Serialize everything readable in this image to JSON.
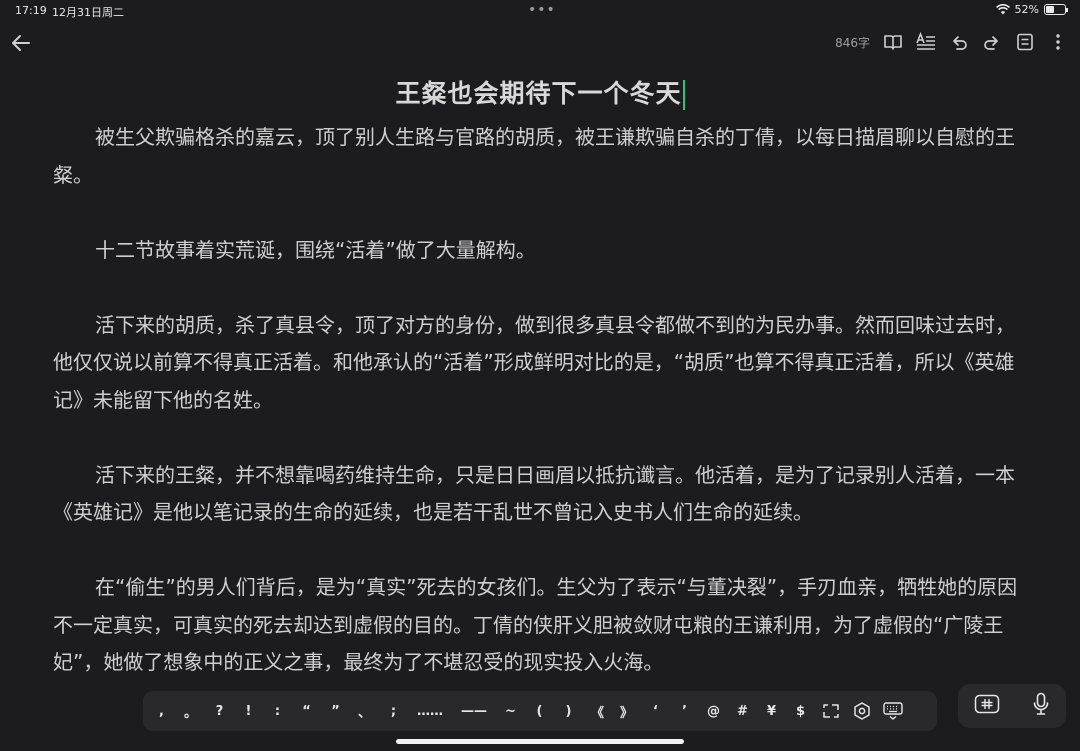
{
  "status": {
    "time": "17:19",
    "date": "12月31日周二",
    "battery": "52%",
    "battery_level": 0.52
  },
  "toolbar": {
    "word_count": "846字"
  },
  "document": {
    "title": "王粲也会期待下一个冬天",
    "paragraphs": [
      "被生父欺骗格杀的嘉云，顶了别人生路与官路的胡质，被王谦欺骗自杀的丁倩，以每日描眉聊以自慰的王粲。",
      "十二节故事着实荒诞，围绕“活着”做了大量解构。",
      "活下来的胡质，杀了真县令，顶了对方的身份，做到很多真县令都做不到的为民办事。然而回味过去时，他仅仅说以前算不得真正活着。和他承认的“活着”形成鲜明对比的是，“胡质”也算不得真正活着，所以《英雄记》未能留下他的名姓。",
      "活下来的王粲，并不想靠喝药维持生命，只是日日画眉以抵抗谶言。他活着，是为了记录别人活着，一本《英雄记》是他以笔记录的生命的延续，也是若干乱世不曾记入史书人们生命的延续。",
      "在“偷生”的男人们背后，是为“真实”死去的女孩们。生父为了表示“与董决裂”，手刃血亲，牺牲她的原因不一定真实，可真实的死去却达到虚假的目的。丁倩的侠肝义胆被敛财屯粮的王谦利用，为了虚假的“广陵王妃”，她做了想象中的正义之事，最终为了不堪忍受的现实投入火海。"
    ]
  },
  "keyboard": {
    "keys": [
      ",",
      "。",
      "?",
      "!",
      ":",
      "“",
      "”",
      "、",
      ";",
      "……",
      "——",
      "~",
      "(",
      ")",
      "《",
      "》",
      "‘",
      "’",
      "@",
      "#",
      "¥",
      "$"
    ],
    "icons": [
      "convert-icon",
      "settings-hex-icon",
      "keyboard-hide-icon",
      "input-method-icon",
      "microphone-icon"
    ]
  }
}
